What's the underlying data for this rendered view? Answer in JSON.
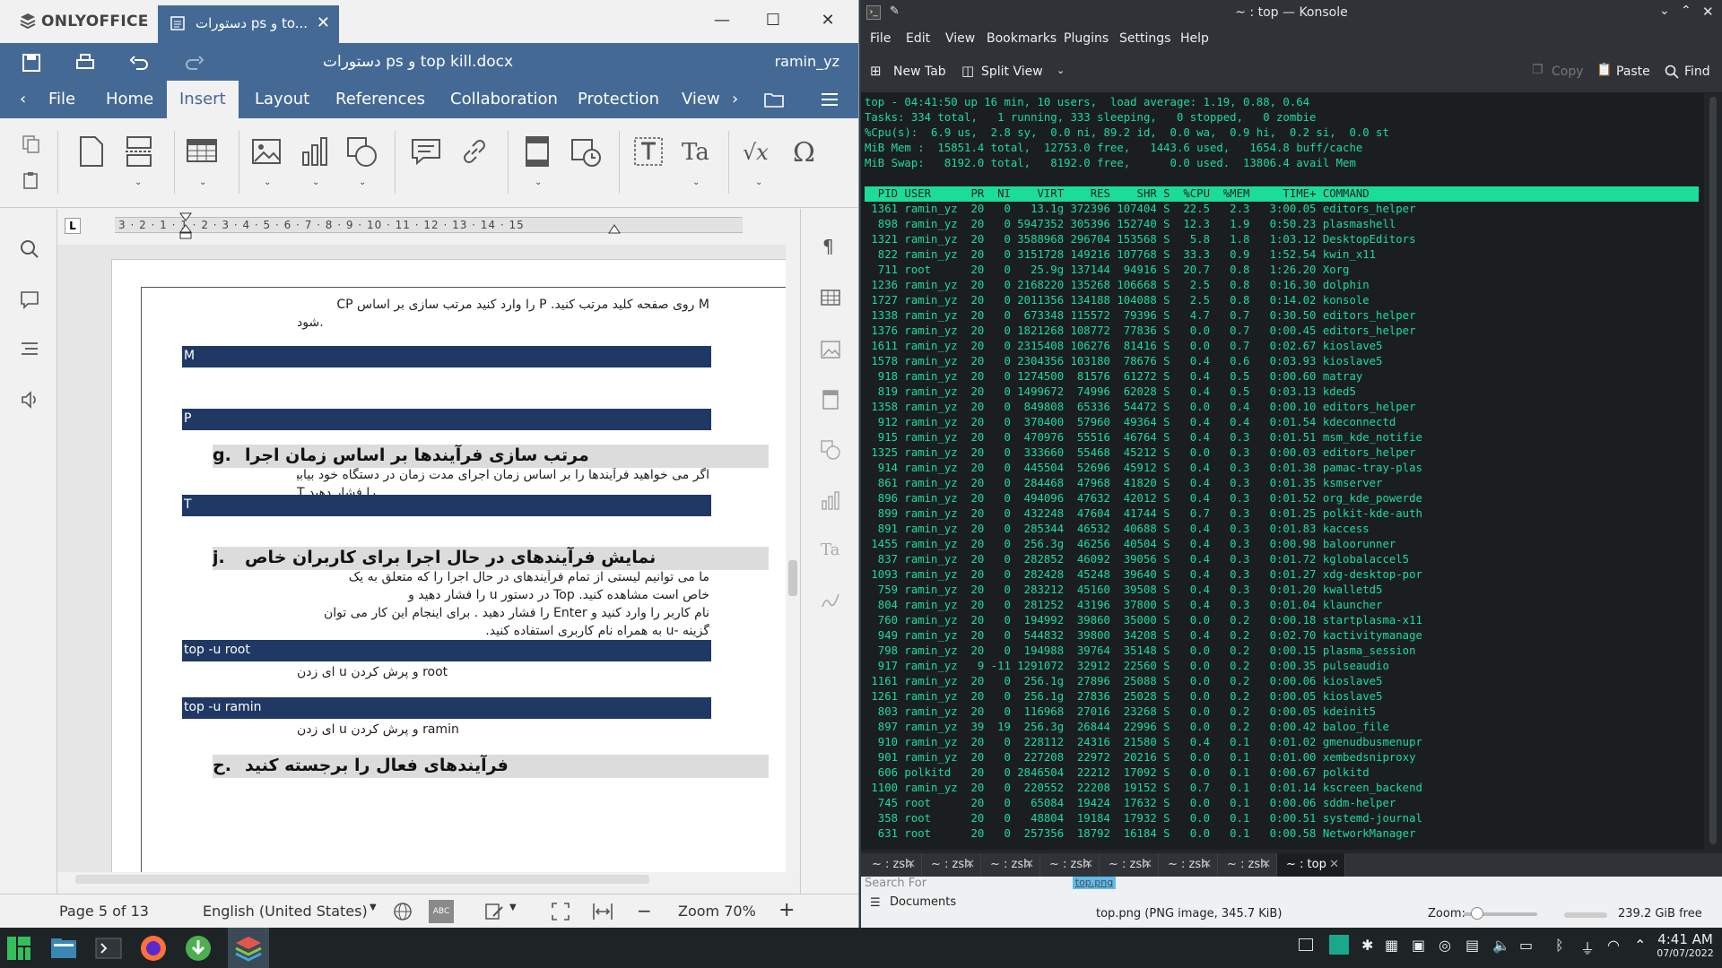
{
  "onlyoffice": {
    "brand": "ONLYOFFICE",
    "doc_tab_label": "دستورات ps و to...",
    "filename": "دستورات ps و top kill.docx",
    "user": "ramin_yz",
    "tabs": [
      "File",
      "Home",
      "Insert",
      "Layout",
      "References",
      "Collaboration",
      "Protection",
      "View"
    ],
    "active_tab": "Insert",
    "ruler_numbers": "3 · 2 · 1 · 1 · 2 · 3 · 4 · 5 · 6 · 7 · 8 · 9 · 10 · 11 · 12 · 13 · 14 · 15",
    "ruler_tab_marker": "L",
    "document": {
      "para1_line1": "M روی صفحه کلید مرتب کنید. P را وارد کنید مرتب سازی بر اساس CP",
      "para1_line2": "شود.",
      "bar_m": "M",
      "bar_p": "P",
      "heading_g_num": "g.",
      "heading_g": "مرتب سازی فرآیندها بر اساس زمان اجرا",
      "para_g_line1": "اگر می خواهید فرآیندها را بر اساس زمان اجرای مدت زمان در دستگاه خود بیابید، کلید",
      "para_g_line2": "T را فشار دهید .",
      "bar_t": "T",
      "heading_j_num": "j.",
      "heading_j": "نمایش فرآیندهای در حال اجرا برای کاربران خاص",
      "para_j_line1": "ما می توانیم لیستی از تمام فرآیندهای در حال اجرا را که متعلق به یک",
      "para_j_line2": "خاص است مشاهده کنید. Top در دستور u را فشار دهید و",
      "para_j_line3": "نام کاربر را وارد کنید و Enter را فشار دهید . برای اینجام این کار می توان",
      "para_j_line4": "گزینه -u به همراه نام کاربری استفاده کنید.",
      "bar_top_root": "top -u root",
      "line_root": "ای زدن u و پرش کردن root",
      "bar_top_ramin": "top -u ramin",
      "line_ramin": "ای زدن u و پرش کردن ramin",
      "heading_k_num": "ح.",
      "heading_k": "فرآیندهای فعال را برجسته کنید"
    },
    "status": {
      "page": "Page 5 of 13",
      "language": "English (United States)",
      "zoom": "Zoom 70%"
    }
  },
  "konsole": {
    "title": "~ : top — Konsole",
    "menu": [
      "File",
      "Edit",
      "View",
      "Bookmarks",
      "Plugins",
      "Settings",
      "Help"
    ],
    "toolbar": {
      "new_tab": "New Tab",
      "split_view": "Split View",
      "copy": "Copy",
      "paste": "Paste",
      "find": "Find"
    },
    "summary": [
      "top - 04:41:50 up 16 min, 10 users,  load average: 1.19, 0.88, 0.64",
      "Tasks: 334 total,   1 running, 333 sleeping,   0 stopped,   0 zombie",
      "%Cpu(s):  6.9 us,  2.8 sy,  0.0 ni, 89.2 id,  0.0 wa,  0.9 hi,  0.2 si,  0.0 st",
      "MiB Mem :  15851.4 total,  12753.0 free,   1443.6 used,   1654.8 buff/cache",
      "MiB Swap:   8192.0 total,   8192.0 free,      0.0 used.  13806.4 avail Mem"
    ],
    "header": "  PID USER      PR  NI    VIRT    RES    SHR S  %CPU  %MEM     TIME+ COMMAND",
    "processes": [
      " 1361 ramin_yz  20   0   13.1g 372396 107404 S  22.5   2.3   3:00.05 editors_helper",
      "  898 ramin_yz  20   0 5947352 305396 152740 S  12.3   1.9   0:50.23 plasmashell",
      " 1321 ramin_yz  20   0 3588968 296704 153568 S   5.8   1.8   1:03.12 DesktopEditors",
      "  822 ramin_yz  20   0 3151728 149216 107768 S  33.3   0.9   1:52.54 kwin_x11",
      "  711 root      20   0   25.9g 137144  94916 S  20.7   0.8   1:26.20 Xorg",
      " 1236 ramin_yz  20   0 2168220 135268 106668 S   2.5   0.8   0:16.30 dolphin",
      " 1727 ramin_yz  20   0 2011356 134188 104088 S   2.5   0.8   0:14.02 konsole",
      " 1338 ramin_yz  20   0  673348 115572  79396 S   4.7   0.7   0:30.50 editors_helper",
      " 1376 ramin_yz  20   0 1821268 108772  77836 S   0.0   0.7   0:00.45 editors_helper",
      " 1611 ramin_yz  20   0 2315408 106276  81416 S   0.0   0.7   0:02.67 kioslave5",
      " 1578 ramin_yz  20   0 2304356 103180  78676 S   0.4   0.6   0:03.93 kioslave5",
      "  918 ramin_yz  20   0 1274500  81576  61272 S   0.4   0.5   0:00.60 matray",
      "  819 ramin_yz  20   0 1499672  74996  62028 S   0.4   0.5   0:03.13 kded5",
      " 1358 ramin_yz  20   0  849808  65336  54472 S   0.0   0.4   0:00.10 editors_helper",
      "  912 ramin_yz  20   0  370400  57960  49364 S   0.4   0.4   0:01.54 kdeconnectd",
      "  915 ramin_yz  20   0  470976  55516  46764 S   0.4   0.3   0:01.51 msm_kde_notifie",
      " 1325 ramin_yz  20   0  333660  55468  45212 S   0.0   0.3   0:00.03 editors_helper",
      "  914 ramin_yz  20   0  445504  52696  45912 S   0.4   0.3   0:01.38 pamac-tray-plas",
      "  861 ramin_yz  20   0  284468  47968  41820 S   0.4   0.3   0:01.35 ksmserver",
      "  896 ramin_yz  20   0  494096  47632  42012 S   0.4   0.3   0:01.52 org_kde_powerde",
      "  899 ramin_yz  20   0  432248  47604  41744 S   0.7   0.3   0:01.25 polkit-kde-auth",
      "  891 ramin_yz  20   0  285344  46532  40688 S   0.4   0.3   0:01.83 kaccess",
      " 1455 ramin_yz  20   0  256.3g  46256  40504 S   0.4   0.3   0:00.98 baloorunner",
      "  837 ramin_yz  20   0  282852  46092  39056 S   0.4   0.3   0:01.72 kglobalaccel5",
      " 1093 ramin_yz  20   0  282428  45248  39640 S   0.4   0.3   0:01.27 xdg-desktop-por",
      "  759 ramin_yz  20   0  283212  45160  39508 S   0.4   0.3   0:01.20 kwalletd5",
      "  804 ramin_yz  20   0  281252  43196  37800 S   0.4   0.3   0:01.04 klauncher",
      "  760 ramin_yz  20   0  194992  39860  35000 S   0.0   0.2   0:00.18 startplasma-x11",
      "  949 ramin_yz  20   0  544832  39800  34208 S   0.4   0.2   0:02.70 kactivitymanage",
      "  798 ramin_yz  20   0  194988  39764  35148 S   0.0   0.2   0:00.15 plasma_session",
      "  917 ramin_yz   9 -11 1291072  32912  22560 S   0.0   0.2   0:00.35 pulseaudio",
      " 1161 ramin_yz  20   0  256.1g  27896  25088 S   0.0   0.2   0:00.06 kioslave5",
      " 1261 ramin_yz  20   0  256.1g  27836  25028 S   0.0   0.2   0:00.05 kioslave5",
      "  803 ramin_yz  20   0  116968  27016  23268 S   0.0   0.2   0:00.05 kdeinit5",
      "  897 ramin_yz  39  19  256.3g  26844  22996 S   0.0   0.2   0:00.42 baloo_file",
      "  910 ramin_yz  20   0  228112  24316  21580 S   0.4   0.1   0:01.02 gmenudbusmenupr",
      "  901 ramin_yz  20   0  227208  22972  20216 S   0.0   0.1   0:01.00 xembedsniproxy",
      "  606 polkitd   20   0 2846504  22212  17092 S   0.0   0.1   0:00.67 polkitd",
      " 1100 ramin_yz  20   0  220552  22208  19152 S   0.7   0.1   0:01.14 kscreen_backend",
      "  745 root      20   0   65084  19424  17632 S   0.0   0.1   0:00.06 sddm-helper",
      "  358 root      20   0   48804  19184  17932 S   0.0   0.1   0:00.51 systemd-journal",
      "  631 root      20   0  257356  18792  16184 S   0.0   0.1   0:00.58 NetworkManager"
    ],
    "tabs": [
      "~ : zsh",
      "~ : zsh",
      "~ : zsh",
      "~ : zsh",
      "~ : zsh",
      "~ : zsh",
      "~ : zsh",
      "~ : top"
    ],
    "active_tab_index": 7
  },
  "dolphin": {
    "search_for": "Search For",
    "place": "Documents",
    "selected_file": "top.png",
    "file_info": "top.png (PNG image, 345.7 KiB)",
    "zoom_label": "Zoom:",
    "free_space": "239.2 GiB free"
  },
  "taskbar": {
    "time": "4:41 AM",
    "date": "07/07/2022"
  }
}
